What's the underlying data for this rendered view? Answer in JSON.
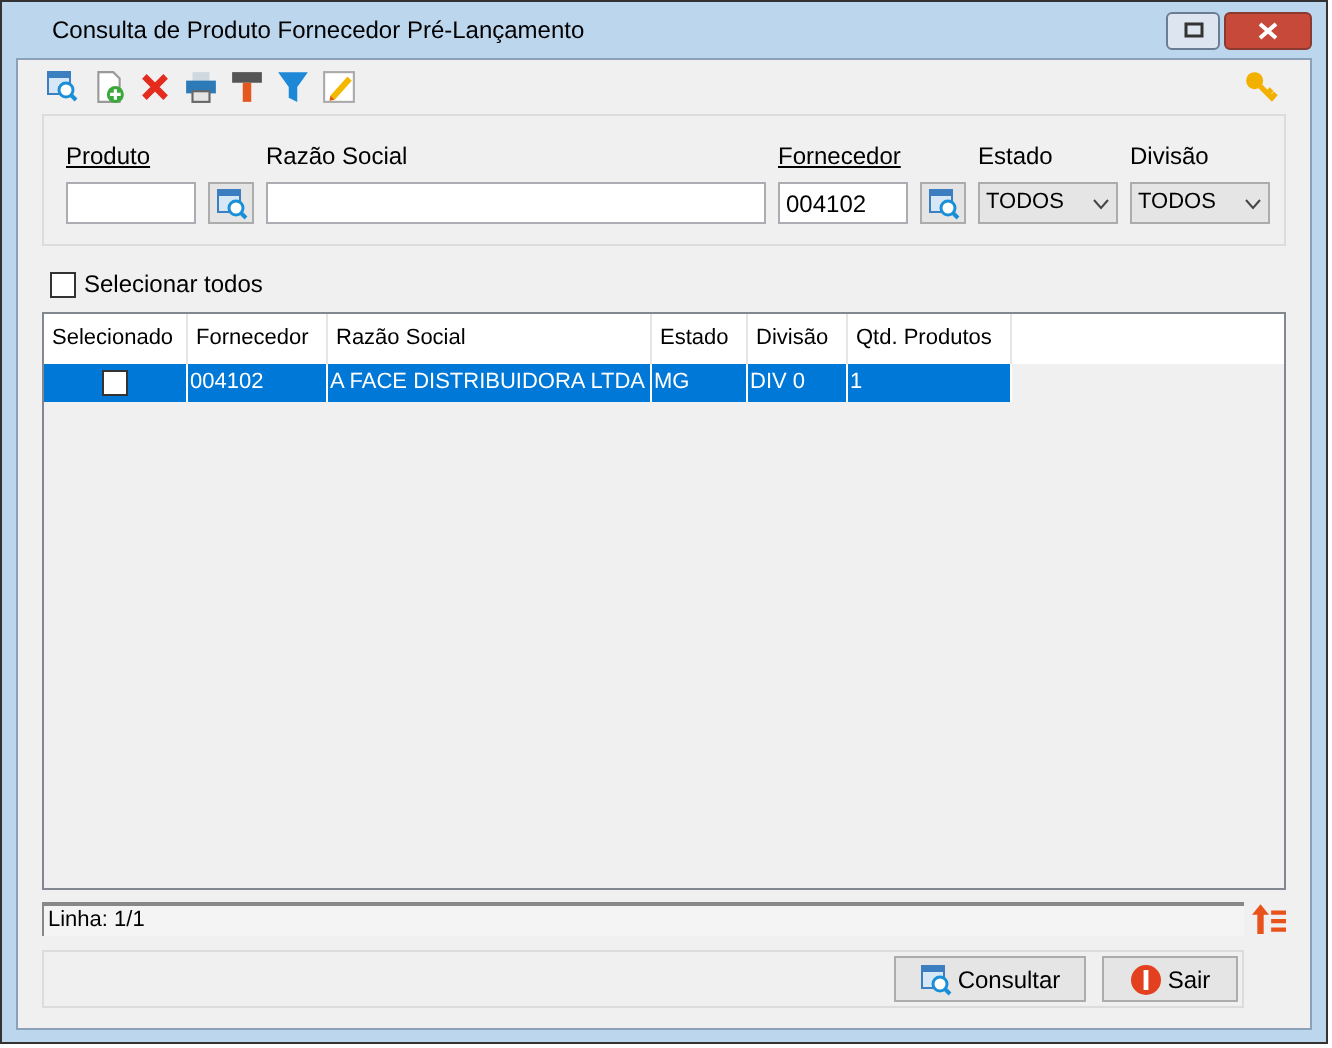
{
  "window": {
    "title": "Consulta de Produto Fornecedor Pré-Lançamento"
  },
  "filters": [
    {
      "kind": "lookup",
      "label": "Produto"
    },
    {
      "kind": "text",
      "label": "Razão Social"
    },
    {
      "kind": "lookup",
      "label": "Fornecedor",
      "value": "004102"
    },
    {
      "kind": "select",
      "label": "Estado",
      "value": "TODOS"
    },
    {
      "kind": "select",
      "label": "Divisão",
      "value": "TODOS"
    }
  ],
  "select_all": {
    "label": "Selecionar todos",
    "checked": false
  },
  "table": {
    "columns": [
      "Selecionado",
      "Fornecedor",
      "Razão Social",
      "Estado",
      "Divisão",
      "Qtd. Produtos"
    ],
    "rows": [
      {
        "selected": true,
        "checked": false,
        "cells": [
          "",
          "004102",
          "A FACE DISTRIBUIDORA LTDA",
          "MG",
          "DIV 0",
          "1"
        ]
      }
    ]
  },
  "status_bar": "Linha: 1/1",
  "buttons": [
    {
      "kind": "search",
      "label": "Consultar"
    },
    {
      "kind": "exit",
      "label": "Sair"
    }
  ]
}
